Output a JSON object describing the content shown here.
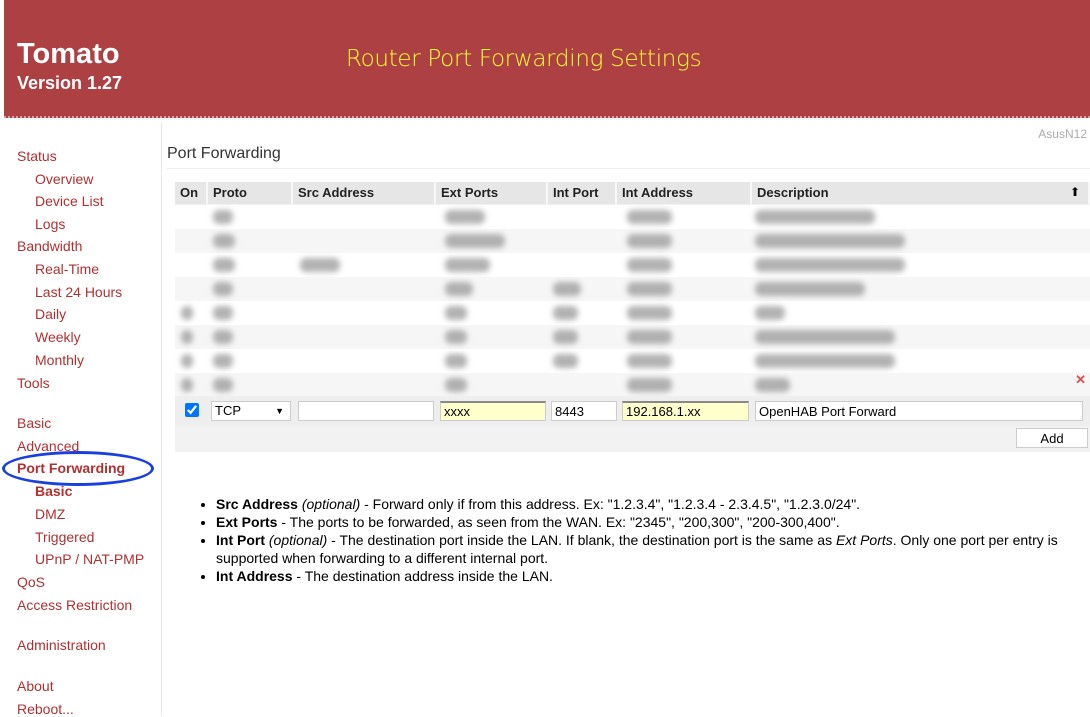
{
  "header": {
    "brand": "Tomato",
    "version": "Version 1.27",
    "overlay_title": "Router Port Forwarding Settings"
  },
  "router_name": "AsusN12",
  "sidebar": {
    "items": [
      {
        "label": "Status",
        "level": "top"
      },
      {
        "label": "Overview",
        "level": "sub"
      },
      {
        "label": "Device List",
        "level": "sub"
      },
      {
        "label": "Logs",
        "level": "sub"
      },
      {
        "label": "Bandwidth",
        "level": "top"
      },
      {
        "label": "Real-Time",
        "level": "sub"
      },
      {
        "label": "Last 24 Hours",
        "level": "sub"
      },
      {
        "label": "Daily",
        "level": "sub"
      },
      {
        "label": "Weekly",
        "level": "sub"
      },
      {
        "label": "Monthly",
        "level": "sub"
      },
      {
        "label": "Tools",
        "level": "top"
      },
      {
        "label": "Basic",
        "level": "top"
      },
      {
        "label": "Advanced",
        "level": "top"
      },
      {
        "label": "Port Forwarding",
        "level": "top",
        "active": true
      },
      {
        "label": "Basic",
        "level": "sub",
        "active": true
      },
      {
        "label": "DMZ",
        "level": "sub"
      },
      {
        "label": "Triggered",
        "level": "sub"
      },
      {
        "label": "UPnP / NAT-PMP",
        "level": "sub"
      },
      {
        "label": "QoS",
        "level": "top"
      },
      {
        "label": "Access Restriction",
        "level": "top"
      },
      {
        "label": "Administration",
        "level": "top"
      },
      {
        "label": "About",
        "level": "top"
      },
      {
        "label": "Reboot...",
        "level": "top"
      }
    ]
  },
  "main": {
    "title": "Port Forwarding",
    "columns": [
      "On",
      "Proto",
      "Src Address",
      "Ext Ports",
      "Int Port",
      "Int Address",
      "Description"
    ],
    "sort_icon": "arrow-up-icon",
    "new_row": {
      "on": true,
      "proto": "TCP",
      "src_address": "",
      "ext_ports": "xxxx",
      "int_port": "8443",
      "int_address": "192.168.1.xx",
      "description": "OpenHAB Port Forward"
    },
    "add_label": "Add",
    "delete_icon": "x-icon",
    "notes": [
      {
        "term": "Src Address",
        "opt": "(optional)",
        "text": " - Forward only if from this address. Ex: \"1.2.3.4\", \"1.2.3.4 - 2.3.4.5\", \"1.2.3.0/24\"."
      },
      {
        "term": "Ext Ports",
        "opt": "",
        "text": " - The ports to be forwarded, as seen from the WAN. Ex: \"2345\", \"200,300\", \"200-300,400\"."
      },
      {
        "term": "Int Port",
        "opt": "(optional)",
        "text": " - The destination port inside the LAN. If blank, the destination port is the same as ",
        "em": "Ext Ports",
        "text2": ". Only one port per entry is supported when forwarding to a different internal port."
      },
      {
        "term": "Int Address",
        "opt": "",
        "text": " - The destination address inside the LAN."
      }
    ]
  },
  "colors": {
    "header": "#ad4042",
    "nav": "#b03030",
    "overlay_title": "#ffff33",
    "highlight_circle": "#1a3fe0"
  }
}
